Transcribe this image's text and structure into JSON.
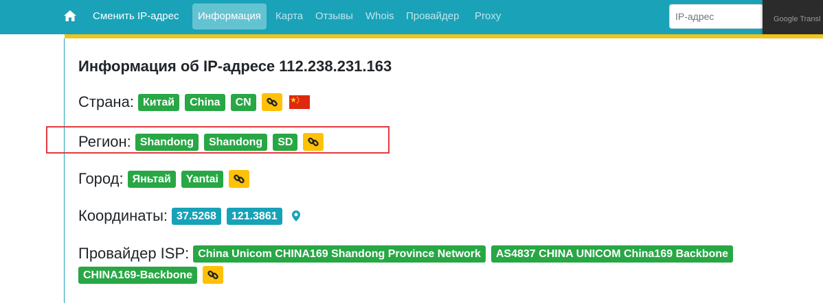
{
  "nav": {
    "brand": "Сменить IP-адрес",
    "items": [
      "Информация",
      "Карта",
      "Отзывы",
      "Whois",
      "Провайдер",
      "Proxy"
    ],
    "search_placeholder": "IP-адрес",
    "translate_label": "Google Transl",
    "bar_color": "#1aa2b8"
  },
  "main": {
    "heading": "Информация об IP-адресе 112.238.231.163",
    "country": {
      "label": "Страна:",
      "badges": [
        "Китай",
        "China",
        "CN"
      ]
    },
    "region": {
      "label": "Регион:",
      "badges": [
        "Shandong",
        "Shandong",
        "SD"
      ]
    },
    "city": {
      "label": "Город:",
      "badges": [
        "Яньтай",
        "Yantai"
      ]
    },
    "coords": {
      "label": "Координаты:",
      "badges": [
        "37.5268",
        "121.3861"
      ]
    },
    "isp": {
      "label": "Провайдер ISP:",
      "badges": [
        "China Unicom CHINA169 Shandong Province Network",
        "AS4837 CHINA UNICOM China169 Backbone",
        "CHINA169-Backbone"
      ]
    }
  },
  "icons": {
    "home": "home-icon",
    "link": "chain-link-icon",
    "flag": "china-flag-icon",
    "location": "map-pin-icon"
  },
  "colors": {
    "badge_green": "#28a745",
    "badge_teal": "#17a2b8",
    "badge_link": "#ffc107",
    "accent_line": "#f0c419",
    "highlight": "#e0393e"
  }
}
